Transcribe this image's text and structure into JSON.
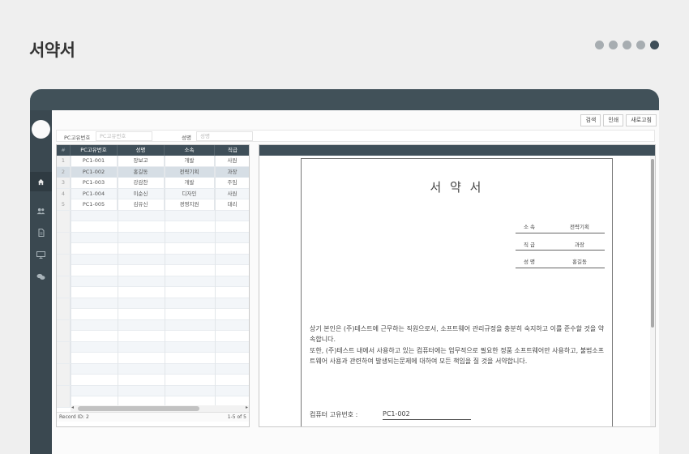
{
  "page_title": "서약서",
  "pager_dots": {
    "count": 5,
    "active_index": 4
  },
  "toolbar": {
    "search_label": "검색",
    "print_label": "인쇄",
    "refresh_label": "새로고침"
  },
  "search": {
    "pc_label": "PC고유번호",
    "pc_placeholder": "PC고유번호",
    "name_label": "성명",
    "name_placeholder": "성명"
  },
  "grid": {
    "columns": [
      "#",
      "PC고유번호",
      "성명",
      "소속",
      "직급"
    ],
    "rows": [
      {
        "num": "1",
        "pc_id": "PC1-001",
        "name": "장보고",
        "dept": "개발",
        "rank": "사원"
      },
      {
        "num": "2",
        "pc_id": "PC1-002",
        "name": "홍길동",
        "dept": "전략기획",
        "rank": "과장"
      },
      {
        "num": "3",
        "pc_id": "PC1-003",
        "name": "강감찬",
        "dept": "개발",
        "rank": "주임"
      },
      {
        "num": "4",
        "pc_id": "PC1-004",
        "name": "이순신",
        "dept": "디자인",
        "rank": "사원"
      },
      {
        "num": "5",
        "pc_id": "PC1-005",
        "name": "김유신",
        "dept": "경영지원",
        "rank": "대리"
      }
    ],
    "selected_index": 1,
    "record_text": "Record ID: 2",
    "page_text": "1-5 of 5"
  },
  "document": {
    "title": "서 약 서",
    "info": [
      {
        "label": "소 속",
        "value": "전략기획"
      },
      {
        "label": "직 급",
        "value": "과장"
      },
      {
        "label": "성 명",
        "value": "홍길동"
      }
    ],
    "paragraph1": "  상기 본인은 (주)테스트에 근무하는 직원으로서, 소프트웨어 관리규정을 충분히 숙지하고 이를 준수할 것을 약속합니다.",
    "paragraph2": "  또한, (주)테스트 내에서 사용하고 있는 컴퓨터에는 업무적으로 필요한 정품 소프트웨어만 사용하고, 불법소프트웨어 사용과 관련하여 발생되는문제에 대하여 모든 책임을 질 것을 서약합니다.",
    "pc_label": "컴퓨터 고유번호 :",
    "pc_value": "PC1-002"
  },
  "icons": {
    "home": "home-icon",
    "users": "users-icon",
    "document": "document-icon",
    "monitor": "monitor-icon",
    "chat": "chat-icon"
  },
  "colors": {
    "header_dark": "#3f4f59",
    "frame": "#415159",
    "dot_active": "#3f4f59",
    "dot_inactive": "#a7adb1"
  }
}
